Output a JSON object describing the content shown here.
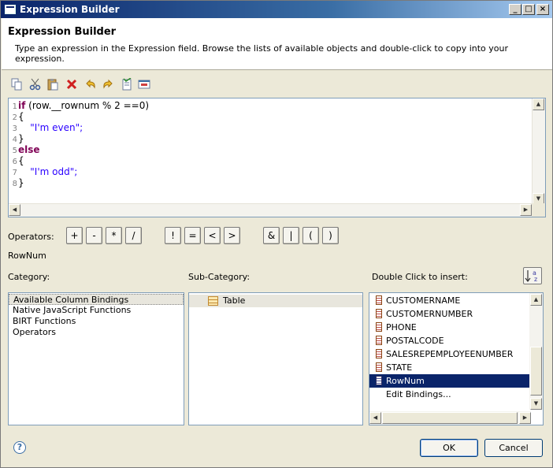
{
  "window": {
    "title": "Expression Builder",
    "controls": {
      "minimize": "_",
      "maximize": "□",
      "close": "×"
    }
  },
  "header": {
    "title": "Expression Builder",
    "description": "Type an expression in the Expression field. Browse the lists of available objects and double-click to copy into your expression."
  },
  "toolbar": {
    "icons": [
      "copy-icon",
      "cut-icon",
      "paste-icon",
      "delete-icon",
      "undo-icon",
      "redo-icon",
      "validate-icon",
      "calculate-icon"
    ]
  },
  "editor": {
    "lines": [
      {
        "num": "1",
        "kw": "if",
        "text": " (row.__rownum % 2 ==0)"
      },
      {
        "num": "2",
        "kw": "",
        "text": "{"
      },
      {
        "num": "3",
        "kw": "",
        "text": "    ",
        "str": "\"I'm even\";"
      },
      {
        "num": "4",
        "kw": "",
        "text": "}"
      },
      {
        "num": "5",
        "kw": "else",
        "text": ""
      },
      {
        "num": "6",
        "kw": "",
        "text": "{"
      },
      {
        "num": "7",
        "kw": "",
        "text": "    ",
        "str": "\"I'm odd\";"
      },
      {
        "num": "8",
        "kw": "",
        "text": "}"
      }
    ]
  },
  "operators": {
    "label": "Operators:",
    "buttons": [
      "+",
      "-",
      "*",
      "/",
      "!",
      "=",
      "<",
      ">",
      "&",
      "|",
      "(",
      ")"
    ]
  },
  "selection_label": "RowNum",
  "category": {
    "label": "Category:",
    "items": [
      "Available Column Bindings",
      "Native JavaScript Functions",
      "BIRT Functions",
      "Operators"
    ],
    "selected": "Available Column Bindings"
  },
  "subcategory": {
    "label": "Sub-Category:",
    "items": [
      "Table"
    ]
  },
  "insert": {
    "label": "Double Click to insert:",
    "items": [
      "CUSTOMERNAME",
      "CUSTOMERNUMBER",
      "PHONE",
      "POSTALCODE",
      "SALESREPEMPLOYEENUMBER",
      "STATE",
      "RowNum",
      "Edit Bindings..."
    ],
    "selected": "RowNum"
  },
  "footer": {
    "help": "?",
    "ok": "OK",
    "cancel": "Cancel"
  }
}
